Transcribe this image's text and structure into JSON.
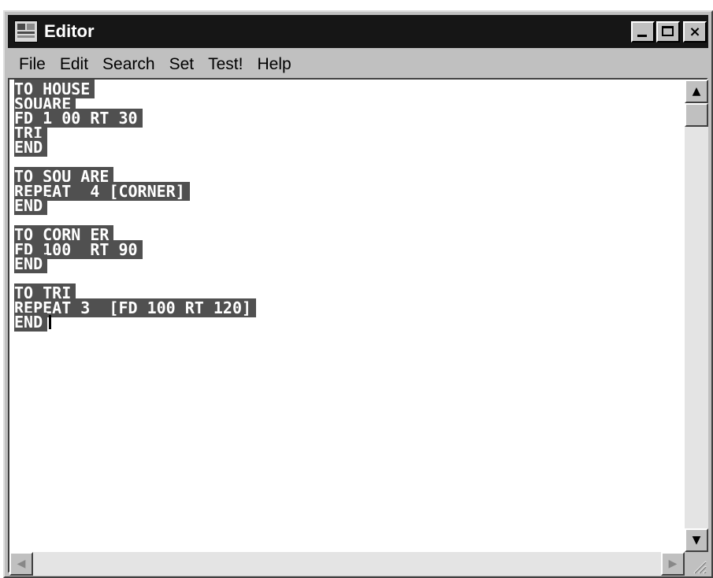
{
  "window": {
    "title": "Editor",
    "icon": "editor-app-icon",
    "controls": {
      "minimize": "minimize-icon",
      "maximize": "maximize-icon",
      "close": "close-icon",
      "close_glyph": "×"
    }
  },
  "menu": [
    {
      "label": "File"
    },
    {
      "label": "Edit"
    },
    {
      "label": "Search"
    },
    {
      "label": "Set"
    },
    {
      "label": "Test!"
    },
    {
      "label": "Help"
    }
  ],
  "editor": {
    "lines": [
      "TO HOUSE",
      "SQUARE",
      "FD 1 00 RT 30",
      "TRI",
      "END",
      "",
      "TO SQU ARE",
      "REPEAT  4 [CORNER]",
      "END",
      "",
      "TO CORN ER",
      "FD 100  RT 90",
      "END",
      "",
      "TO TRI",
      "REPEAT 3  [FD 100 RT 120]",
      "END"
    ],
    "highlight_color": "#505050",
    "text_color": "#ffffff"
  },
  "scrollbars": {
    "up": "▲",
    "down": "▼",
    "left": "◀",
    "right": "▶"
  }
}
